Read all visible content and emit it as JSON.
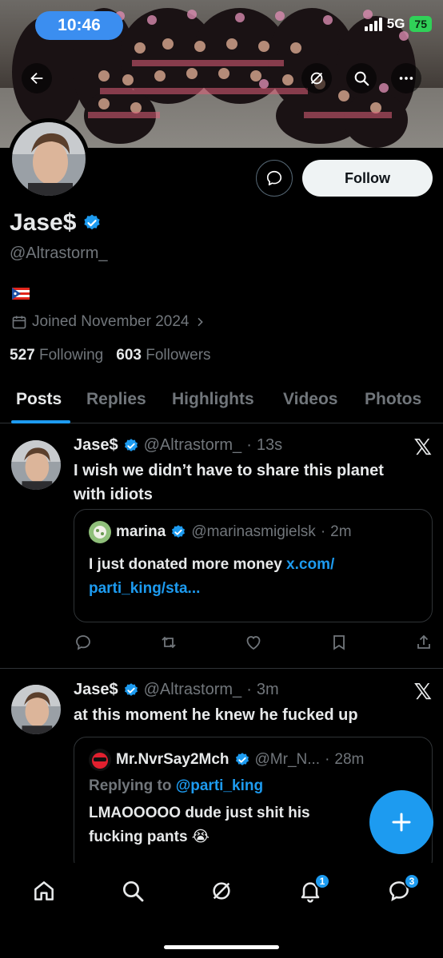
{
  "status_bar": {
    "time": "10:46",
    "network": "5G",
    "battery": "75"
  },
  "profile": {
    "name": "Jase$",
    "handle": "@Altrastorm_",
    "joined": "Joined November 2024",
    "following_count": "527",
    "following_label": "Following",
    "followers_count": "603",
    "followers_label": "Followers",
    "follow_label": "Follow"
  },
  "tabs": [
    "Posts",
    "Replies",
    "Highlights",
    "Videos",
    "Photos"
  ],
  "posts": [
    {
      "name": "Jase$",
      "handle": "@Altrastorm_",
      "time": "13s",
      "text_line1": "I wish we didn’t have to share this planet",
      "text_line2": "with idiots",
      "quote": {
        "name": "marina",
        "handle": "@marinasmigielsk",
        "time": "2m",
        "text": "I just donated more money ",
        "link_line1": "x.com/",
        "link_line2": "parti_king/sta..."
      }
    },
    {
      "name": "Jase$",
      "handle": "@Altrastorm_",
      "time": "3m",
      "text_line1": "at this moment he knew he fucked up",
      "quote": {
        "name": "Mr.NvrSay2Mch",
        "handle": "@Mr_N...",
        "time": "28m",
        "replying_label": "Replying to ",
        "replying_to": "@parti_king",
        "text_line1": "LMAOOOOO dude just shit his",
        "text_line2": "fucking pants 😭"
      }
    }
  ],
  "bottom_nav": {
    "notifications_badge": "1",
    "messages_badge": "3"
  },
  "colors": {
    "accent": "#1d9bf0",
    "background": "#000000",
    "muted": "#71767b"
  }
}
